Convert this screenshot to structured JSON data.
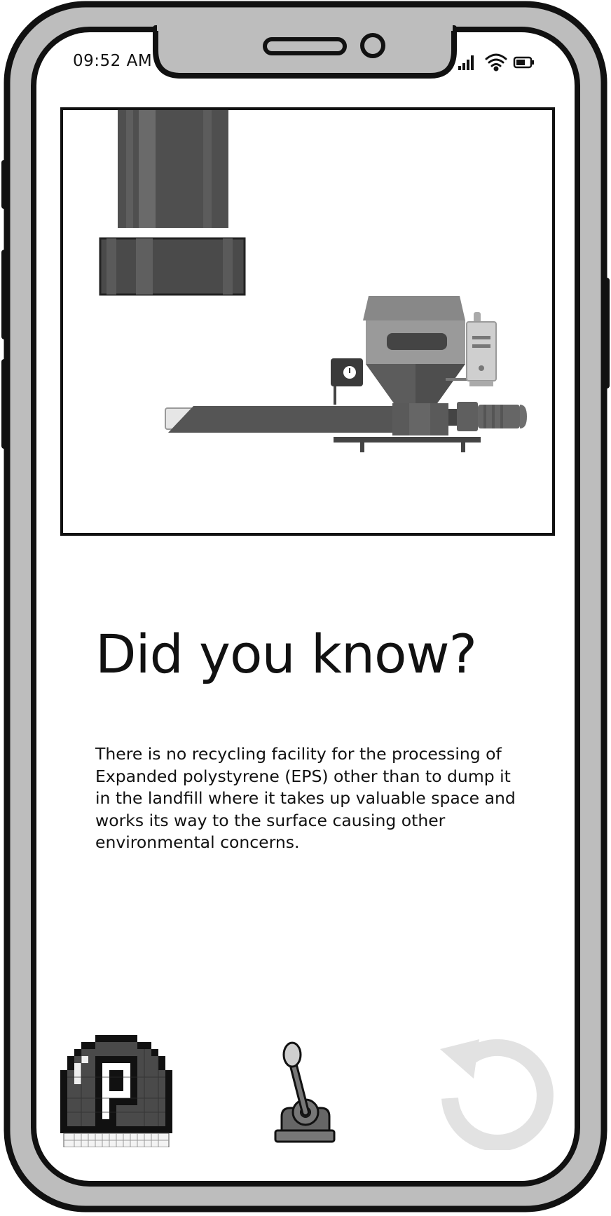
{
  "status_bar": {
    "time": "09:52 AM",
    "icons": [
      "signal-icon",
      "wifi-icon",
      "battery-icon"
    ]
  },
  "hero": {
    "illustration": "eps-recycling-machine"
  },
  "content": {
    "heading": "Did you know?",
    "body": "There is no recycling facility for the processing of Expanded polystyrene (EPS) other than to dump it in the landfill where it takes up valuable space and works its way to the surface causing other environmental concerns."
  },
  "actions": {
    "left_icon": "p-button-icon",
    "center_icon": "lever-icon",
    "right_icon": "reset-icon",
    "right_state": "disabled"
  },
  "colors": {
    "frame": "#bdbdbd",
    "outline": "#111111",
    "machine_dark": "#4a4a4a",
    "machine_mid": "#8a8a8a",
    "disabled_icon": "#e2e2e2"
  }
}
